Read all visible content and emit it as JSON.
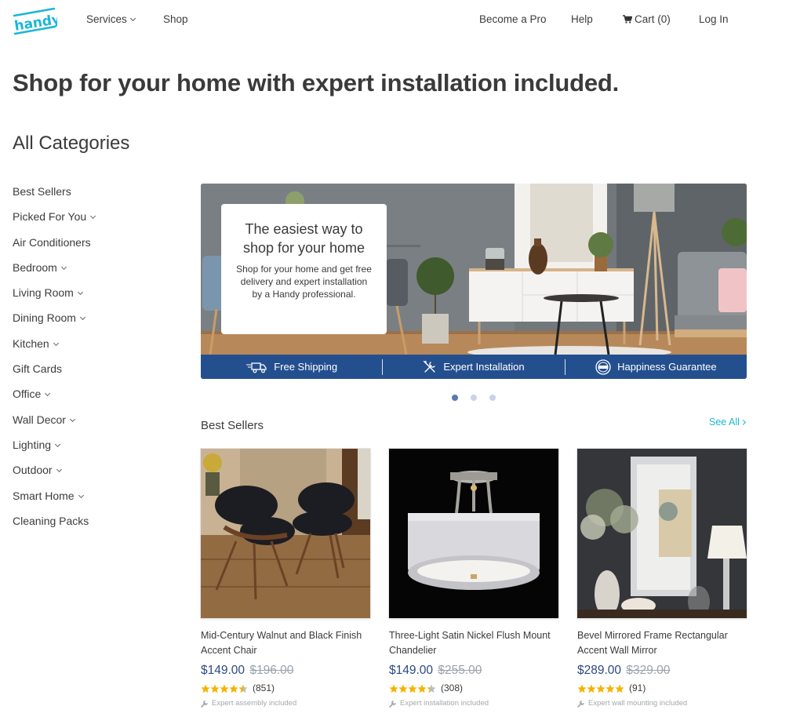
{
  "header": {
    "logo_text": "handy",
    "nav_left": [
      {
        "label": "Services",
        "has_dropdown": true
      },
      {
        "label": "Shop",
        "has_dropdown": false
      }
    ],
    "nav_right": [
      {
        "label": "Become a Pro"
      },
      {
        "label": "Help"
      },
      {
        "label": "Cart (0)",
        "icon": "cart-icon"
      },
      {
        "label": "Log In"
      }
    ]
  },
  "page": {
    "title": "Shop for your home with expert installation included.",
    "categories_title": "All Categories"
  },
  "sidebar": {
    "items": [
      {
        "label": "Best Sellers",
        "has_dropdown": false
      },
      {
        "label": "Picked For You",
        "has_dropdown": true
      },
      {
        "label": "Air Conditioners",
        "has_dropdown": false
      },
      {
        "label": "Bedroom",
        "has_dropdown": true
      },
      {
        "label": "Living Room",
        "has_dropdown": true
      },
      {
        "label": "Dining Room",
        "has_dropdown": true
      },
      {
        "label": "Kitchen",
        "has_dropdown": true
      },
      {
        "label": "Gift Cards",
        "has_dropdown": false
      },
      {
        "label": "Office",
        "has_dropdown": true
      },
      {
        "label": "Wall Decor",
        "has_dropdown": true
      },
      {
        "label": "Lighting",
        "has_dropdown": true
      },
      {
        "label": "Outdoor",
        "has_dropdown": true
      },
      {
        "label": "Smart Home",
        "has_dropdown": true
      },
      {
        "label": "Cleaning Packs",
        "has_dropdown": false
      }
    ]
  },
  "hero": {
    "card_title": "The easiest way to shop for your home",
    "card_body": "Shop for your home and get free delivery and expert installation by a Handy professional.",
    "features": [
      {
        "label": "Free Shipping",
        "icon": "truck-icon"
      },
      {
        "label": "Expert Installation",
        "icon": "tools-icon"
      },
      {
        "label": "Happiness Guarantee",
        "icon": "guarantee-badge-icon"
      }
    ],
    "slides_total": 3,
    "active_slide": 1
  },
  "best_sellers": {
    "title": "Best Sellers",
    "see_all_label": "See All",
    "products": [
      {
        "name": "Mid-Century Walnut and Black Finish Accent Chair",
        "price": "$149.00",
        "old_price": "$196.00",
        "rating": 4.5,
        "rating_count": "(851)",
        "feature": "Expert assembly included",
        "image": "accent-chairs-photo"
      },
      {
        "name": "Three-Light Satin Nickel Flush Mount Chandelier",
        "price": "$149.00",
        "old_price": "$255.00",
        "rating": 4.3,
        "rating_count": "(308)",
        "feature": "Expert installation included",
        "image": "chandelier-photo"
      },
      {
        "name": "Bevel Mirrored Frame Rectangular Accent Wall Mirror",
        "price": "$289.00",
        "old_price": "$329.00",
        "rating": 4.9,
        "rating_count": "(91)",
        "feature": "Expert wall mounting included",
        "image": "wall-mirror-photo"
      }
    ]
  },
  "colors": {
    "brand_cyan": "#1ab6d6",
    "banner_blue": "#244f8e",
    "price_blue": "#2c4a7e",
    "star_gold": "#f5b301",
    "star_empty": "#b8bcc0",
    "dot_active": "#5a79b0",
    "dot_inactive": "#c9d3e6"
  }
}
